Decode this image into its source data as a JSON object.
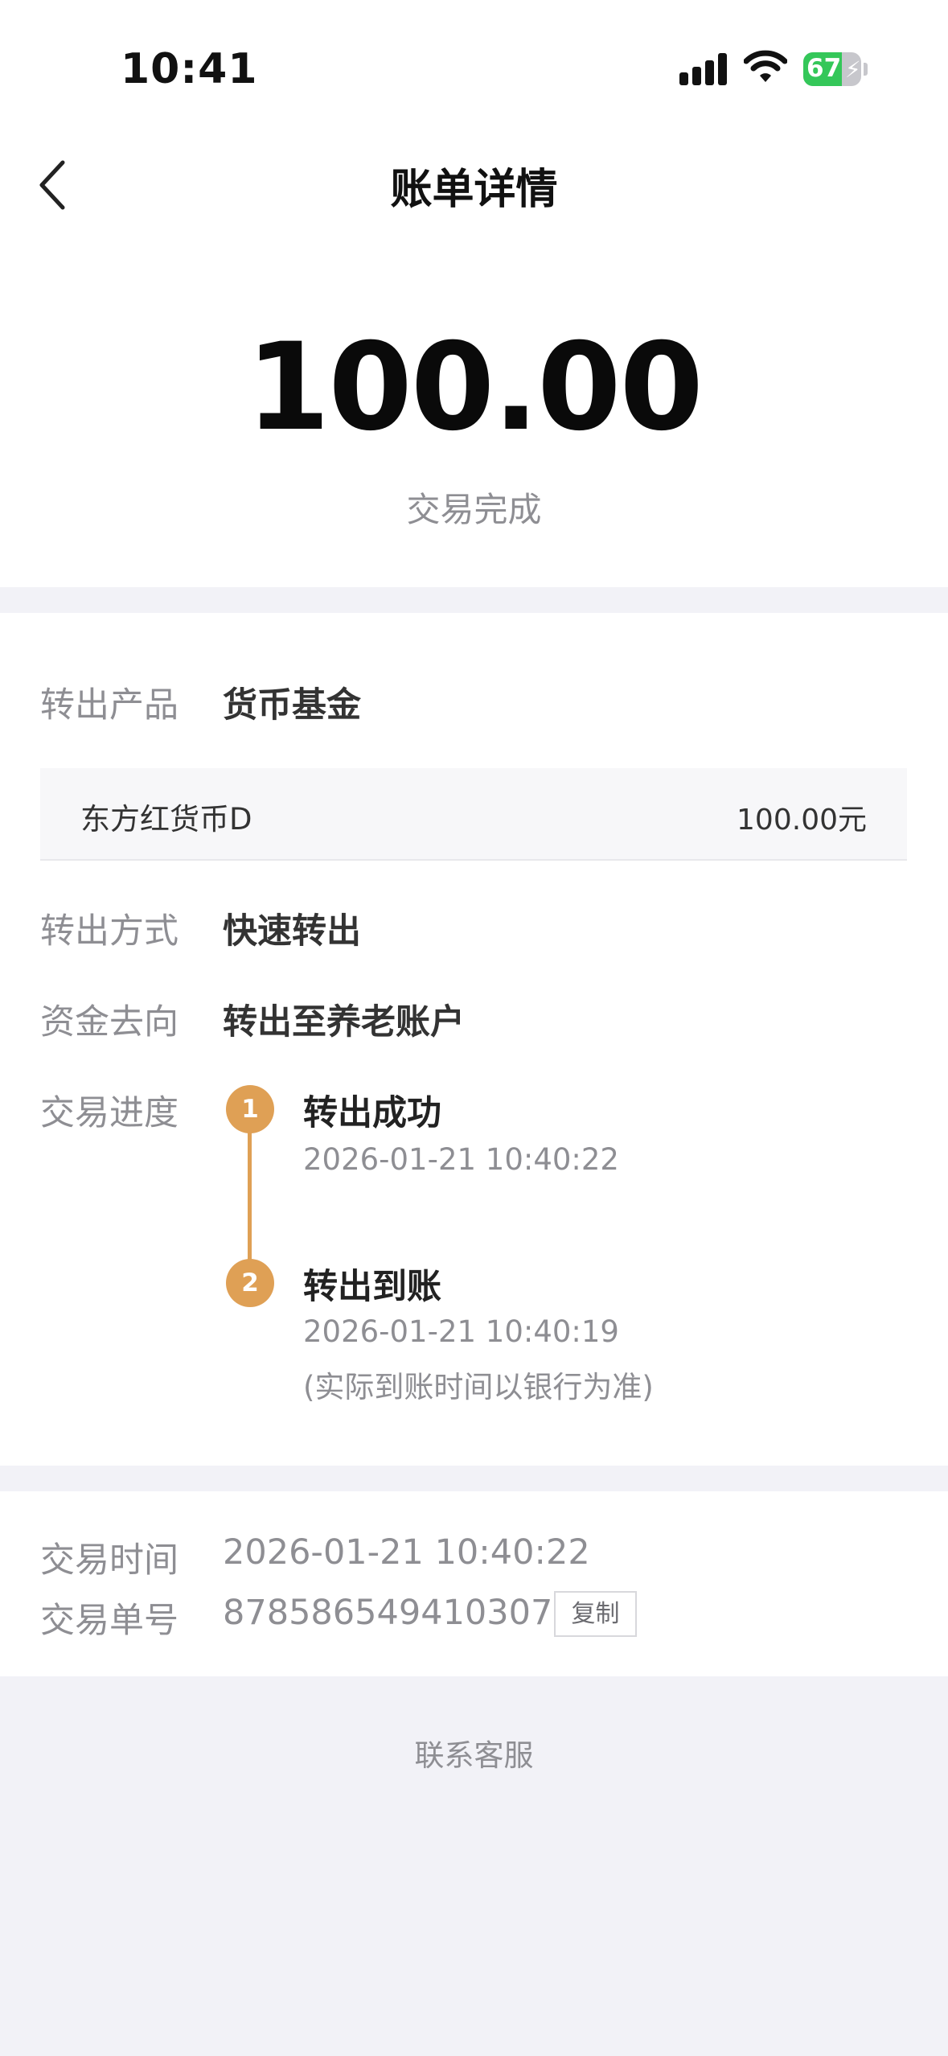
{
  "status_bar": {
    "time": "10:41",
    "battery_percent": "67",
    "battery_level": 0.67,
    "icons": [
      "cellular-signal-icon",
      "wifi-icon",
      "battery-charging-icon"
    ]
  },
  "nav": {
    "back_icon": "chevron-left-icon",
    "title": "账单详情"
  },
  "summary": {
    "amount": "100.00",
    "status": "交易完成"
  },
  "details": {
    "product_label": "转出产品",
    "product_value": "货币基金",
    "fund_name": "东方红货币D",
    "fund_amount": "100.00元",
    "method_label": "转出方式",
    "method_value": "快速转出",
    "destination_label": "资金去向",
    "destination_value": "转出至养老账户",
    "progress_label": "交易进度",
    "steps": [
      {
        "number": "1",
        "title": "转出成功",
        "time": "2026-01-21 10:40:22",
        "note": ""
      },
      {
        "number": "2",
        "title": "转出到账",
        "time": "2026-01-21 10:40:19",
        "note": "(实际到账时间以银行为准)"
      }
    ]
  },
  "info": {
    "time_label": "交易时间",
    "time_value": "2026-01-21 10:40:22",
    "order_label": "交易单号",
    "order_value": "878586549410307",
    "copy_label": "复制"
  },
  "footer": {
    "contact_label": "联系客服"
  },
  "colors": {
    "accent": "#dfa055",
    "background": "#f2f2f7",
    "muted_text": "#8e8e93"
  }
}
